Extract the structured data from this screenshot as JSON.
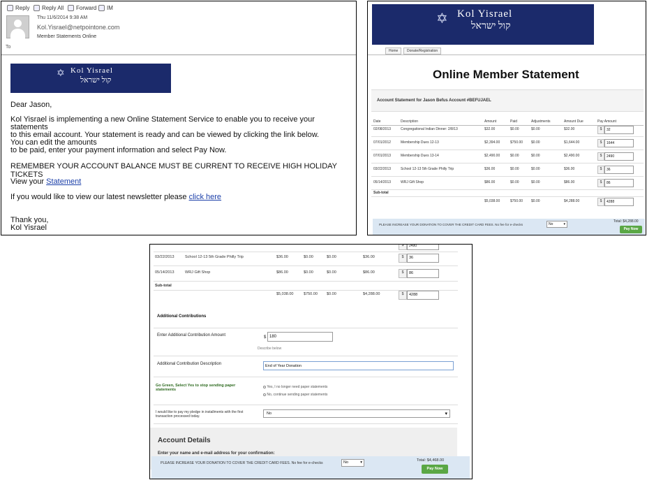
{
  "email": {
    "toolbar": {
      "reply": "Reply",
      "reply_all": "Reply All",
      "forward": "Forward",
      "im": "IM"
    },
    "datetime": "Thu 11/6/2014 9:38 AM",
    "from": "Kol.Yisrael@netpointone.com",
    "subject": "Member Statements Online",
    "to_label": "To",
    "banner": {
      "line1": "Kol Yisrael",
      "line2": "קול ישראל"
    },
    "greeting": "Dear Jason,",
    "para1_l1": "Kol Yisrael is implementing a new Online Statement Service to enable you to receive your",
    "para1_l2": "statements",
    "para1_l3": "to this email account. Your statement is ready and can be viewed by clicking the link below.",
    "para1_l4": "You can edit the amounts",
    "para1_l5": "to be paid, enter your payment information and select Pay Now.",
    "remember": "REMEMBER YOUR ACCOUNT BALANCE MUST BE CURRENT TO RECEIVE HIGH HOLIDAY TICKETS",
    "view_prefix": "View your",
    "view_link": "Statement",
    "newsletter_prefix": "If you would like to view our latest newsletter please",
    "newsletter_link": "click here",
    "signoff1": "Thank you,",
    "signoff2": "Kol Yisrael"
  },
  "statement": {
    "banner": {
      "line1": "Kol Yisrael",
      "line2": "קול ישראל"
    },
    "tabs": [
      "Home",
      "Donate/Registration"
    ],
    "title": "Online Member Statement",
    "account_heading": "Account Statement for Jason Befus Account #BEFUJAEL",
    "headers": [
      "Date",
      "Description",
      "Amount",
      "Paid",
      "Adjustments",
      "Amount Due",
      "Pay Amount"
    ],
    "rows": [
      {
        "date": "02/08/2013",
        "desc": "Congregational Indian Dinner: 2/8/13",
        "amount": "$32.00",
        "paid": "$0.00",
        "adj": "$0.00",
        "due": "$32.00",
        "pay": "32"
      },
      {
        "date": "07/01/2012",
        "desc": "Membership Dues 12-13",
        "amount": "$2,394.00",
        "paid": "$750.00",
        "adj": "$0.00",
        "due": "$1,644.00",
        "pay": "1644"
      },
      {
        "date": "07/01/2013",
        "desc": "Membership Dues 13-14",
        "amount": "$2,490.00",
        "paid": "$0.00",
        "adj": "$0.00",
        "due": "$2,490.00",
        "pay": "2490"
      },
      {
        "date": "03/22/2013",
        "desc": "School 12-13 5th Grade Philly Trip",
        "amount": "$36.00",
        "paid": "$0.00",
        "adj": "$0.00",
        "due": "$36.00",
        "pay": "36"
      },
      {
        "date": "05/14/2013",
        "desc": "WRJ Gift Shop",
        "amount": "$86.00",
        "paid": "$0.00",
        "adj": "$0.00",
        "due": "$86.00",
        "pay": "86"
      }
    ],
    "subtotal_label": "Sub-total",
    "subtotal": {
      "amount": "$5,038.00",
      "paid": "$750.00",
      "adj": "$0.00",
      "due": "$4,288.00",
      "pay": "4288"
    },
    "dollar": "$",
    "fee_text": "PLEASE INCREASE YOUR DONATION TO COVER THE CREDIT CARD FEES. No fee for e-checks",
    "fee_select": "No",
    "total": "Total: $4,288.00",
    "pay_now": "Pay Now"
  },
  "detail": {
    "top_pay": "2490",
    "rows": [
      {
        "date": "03/22/2013",
        "desc": "School 12-13 5th Grade Philly Trip",
        "amount": "$36.00",
        "paid": "$0.00",
        "adj": "$0.00",
        "due": "$36.00",
        "pay": "36"
      },
      {
        "date": "05/14/2013",
        "desc": "WRJ Gift Shop",
        "amount": "$86.00",
        "paid": "$0.00",
        "adj": "$0.00",
        "due": "$86.00",
        "pay": "86"
      }
    ],
    "subtotal_label": "Sub-total",
    "subtotal": {
      "amount": "$5,038.00",
      "paid": "$750.00",
      "adj": "$0.00",
      "due": "$4,288.00",
      "pay": "4288"
    },
    "dollar": "$",
    "additional_heading": "Additional Contributions",
    "contrib_amount_label": "Enter Additional Contribution Amount",
    "contrib_amount_value": "180",
    "describe_below": "Describe below",
    "contrib_desc_label": "Additional Contribution Description",
    "contrib_desc_value": "End of Year Donation",
    "go_green_label": "Go Green, Select Yes to stop sending paper statements",
    "go_green_yes": "Yes, I no longer need paper statements",
    "go_green_no": "No, continue sending paper statements",
    "installments_label": "I would like to pay my pledge in installments with the first transaction processed today.",
    "installments_value": "No",
    "account_details_heading": "Account Details",
    "enter_name_email": "Enter your name and e-mail address for your confirmation:",
    "fee_text": "PLEASE INCREASE YOUR DONATION TO COVER THE CREDIT CARD FEES. No fee for e-checks",
    "fee_select": "No",
    "total": "Total: $4,468.00",
    "pay_now": "Pay Now"
  }
}
